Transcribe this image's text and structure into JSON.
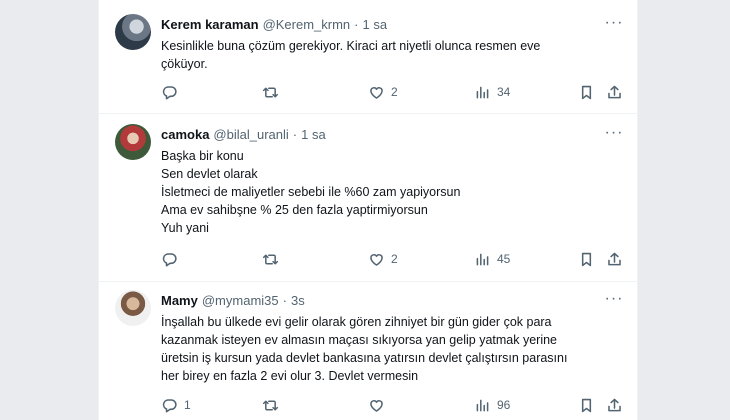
{
  "tweets": [
    {
      "name": "Kerem karaman",
      "handle": "@Kerem_krmn",
      "dot": "·",
      "time": "1 sa",
      "lines": [
        "Kesinlikle buna çözüm gerekiyor. Kiraci art niyetli olunca resmen eve",
        "çöküyor."
      ],
      "replies": "",
      "retweets": "",
      "likes": "2",
      "views": "34"
    },
    {
      "name": "camoka",
      "handle": "@bilal_uranli",
      "dot": "·",
      "time": "1 sa",
      "lines": [
        "Başka bir konu",
        "Sen devlet olarak",
        "İsletmeci de maliyetler sebebi ile %60 zam yapiyorsun",
        "Ama ev sahibşne % 25 den fazla yaptirmiyorsun",
        "Yuh yani"
      ],
      "replies": "",
      "retweets": "",
      "likes": "2",
      "views": "45"
    },
    {
      "name": "Mamy",
      "handle": "@mymami35",
      "dot": "·",
      "time": "3s",
      "lines": [
        "İnşallah bu ülkede evi gelir olarak gören zihniyet bir gün gider çok para",
        "kazanmak isteyen ev almasın maçası sıkıyorsa yan gelip yatmak yerine",
        "üretsin iş kursun yada devlet bankasına yatırsın devlet çalıştırsın parasını",
        "her birey en fazla 2 evi olur 3. Devlet vermesin"
      ],
      "replies": "1",
      "retweets": "",
      "likes": "",
      "views": "96"
    }
  ],
  "icons": {
    "more": "more-horizontal-icon",
    "reply": "reply-icon",
    "retweet": "retweet-icon",
    "like": "heart-icon",
    "views": "views-chart-icon",
    "bookmark": "bookmark-icon",
    "share": "share-icon"
  },
  "colors": {
    "text": "#0f1419",
    "muted": "#536471",
    "border": "#eff3f4",
    "background": "#ffffff",
    "page_background": "#e9ebee"
  }
}
